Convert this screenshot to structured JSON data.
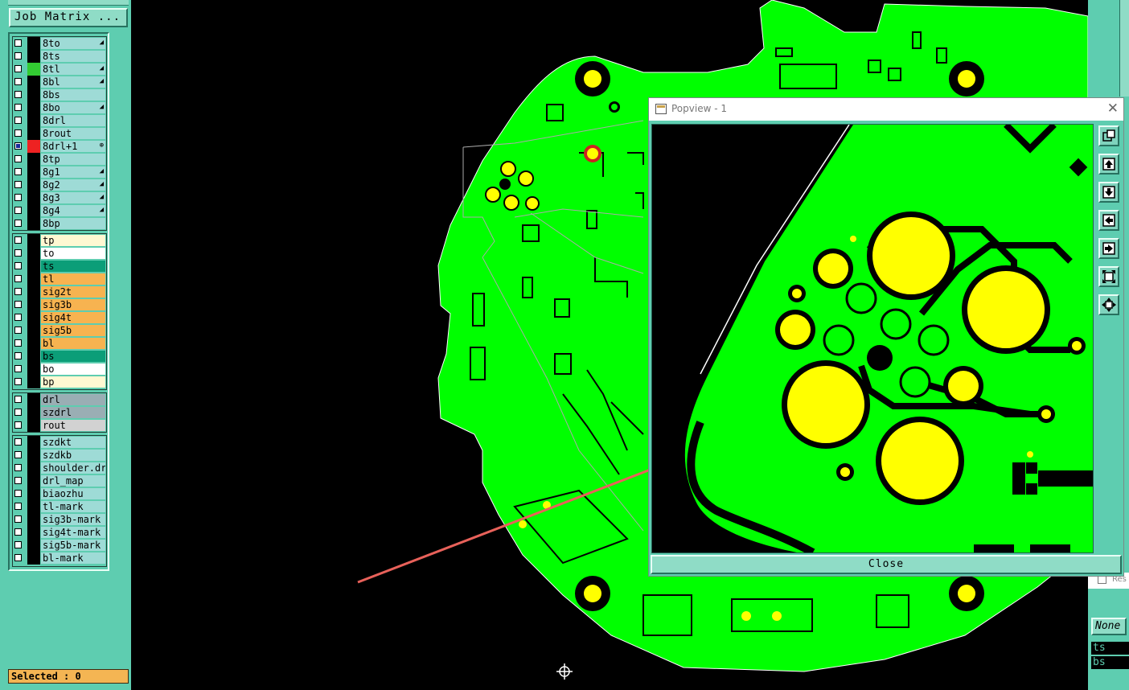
{
  "app": {
    "top_label": "Job Matrix ...",
    "header_text": "",
    "job_matrix_label": "Job Matrix ..."
  },
  "colors": {
    "panel": "#5ecdb0",
    "board": "#00ff00",
    "pad": "#ffff00",
    "annotation_arrow": "#e8615a"
  },
  "layers": {
    "group1": [
      {
        "name": "8to",
        "swatch": "#000000",
        "checked": false,
        "mark": "wrench"
      },
      {
        "name": "8ts",
        "swatch": "#000000",
        "checked": false,
        "mark": ""
      },
      {
        "name": "8tl",
        "swatch": "#33cc33",
        "checked": false,
        "mark": "wrench"
      },
      {
        "name": "8bl",
        "swatch": "#000000",
        "checked": false,
        "mark": "wrench"
      },
      {
        "name": "8bs",
        "swatch": "#000000",
        "checked": false,
        "mark": ""
      },
      {
        "name": "8bo",
        "swatch": "#000000",
        "checked": false,
        "mark": "wrench"
      },
      {
        "name": "8drl",
        "swatch": "#000000",
        "checked": false,
        "mark": ""
      },
      {
        "name": "8rout",
        "swatch": "#000000",
        "checked": false,
        "mark": ""
      },
      {
        "name": "8drl+1",
        "swatch": "#ee2222",
        "checked": true,
        "mark": "target"
      },
      {
        "name": "8tp",
        "swatch": "#000000",
        "checked": false,
        "mark": ""
      },
      {
        "name": "8g1",
        "swatch": "#000000",
        "checked": false,
        "mark": "wrench"
      },
      {
        "name": "8g2",
        "swatch": "#000000",
        "checked": false,
        "mark": "wrench"
      },
      {
        "name": "8g3",
        "swatch": "#000000",
        "checked": false,
        "mark": "wrench"
      },
      {
        "name": "8g4",
        "swatch": "#000000",
        "checked": false,
        "mark": "wrench"
      },
      {
        "name": "8bp",
        "swatch": "#000000",
        "checked": false,
        "mark": ""
      }
    ],
    "group2": [
      {
        "name": "tp",
        "bg": "#fff8d2"
      },
      {
        "name": "to",
        "bg": "#ffffff"
      },
      {
        "name": "ts",
        "bg": "#0b9e78"
      },
      {
        "name": "tl",
        "bg": "#f7b350"
      },
      {
        "name": "sig2t",
        "bg": "#f7b350"
      },
      {
        "name": "sig3b",
        "bg": "#f7b350"
      },
      {
        "name": "sig4t",
        "bg": "#f7b350"
      },
      {
        "name": "sig5b",
        "bg": "#f7b350"
      },
      {
        "name": "bl",
        "bg": "#f7b350"
      },
      {
        "name": "bs",
        "bg": "#0b9e78"
      },
      {
        "name": "bo",
        "bg": "#ffffff"
      },
      {
        "name": "bp",
        "bg": "#fff8d2"
      }
    ],
    "group3": [
      {
        "name": "drl",
        "bg": "#9aaeb4"
      },
      {
        "name": "szdrl",
        "bg": "#9aaeb4"
      },
      {
        "name": "rout",
        "bg": "#d2d2d2"
      }
    ],
    "group4": [
      {
        "name": "szdkt"
      },
      {
        "name": "szdkb"
      },
      {
        "name": "shoulder.drl"
      },
      {
        "name": "drl_map"
      },
      {
        "name": "biaozhu"
      },
      {
        "name": "tl-mark"
      },
      {
        "name": "sig3b-mark"
      },
      {
        "name": "sig4t-mark"
      },
      {
        "name": "sig5b-mark"
      },
      {
        "name": "bl-mark"
      }
    ]
  },
  "status": {
    "selected_label": "Selected : 0"
  },
  "popview": {
    "title": "Popview - 1",
    "close_label": "Close",
    "toolbar": [
      "zoom-fit-icon",
      "pan-up-icon",
      "pan-down-icon",
      "pan-left-icon",
      "pan-right-icon",
      "zoom-in-icon",
      "zoom-out-icon"
    ]
  },
  "right_panel": {
    "none_label": "None",
    "active_layers": [
      "ts",
      "bs"
    ],
    "res_label": "Res"
  }
}
